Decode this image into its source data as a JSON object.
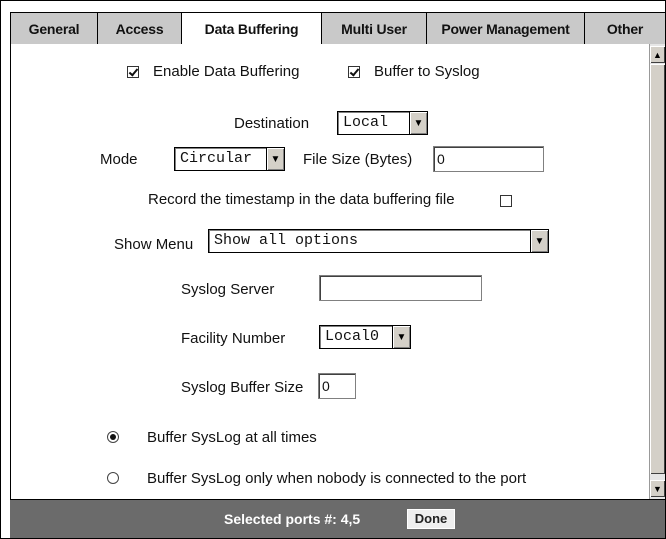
{
  "tabs": [
    {
      "label": "General",
      "active": false
    },
    {
      "label": "Access",
      "active": false
    },
    {
      "label": "Data Buffering",
      "active": true
    },
    {
      "label": "Multi User",
      "active": false
    },
    {
      "label": "Power Management",
      "active": false
    },
    {
      "label": "Other",
      "active": false
    }
  ],
  "options": {
    "enable_data_buffering": {
      "label": "Enable Data Buffering",
      "checked": true
    },
    "buffer_to_syslog": {
      "label": "Buffer to Syslog",
      "checked": true
    }
  },
  "destination": {
    "label": "Destination",
    "value": "Local"
  },
  "mode": {
    "label": "Mode",
    "value": "Circular"
  },
  "file_size": {
    "label": "File Size (Bytes)",
    "value": "0"
  },
  "timestamp": {
    "label": "Record the timestamp in the data buffering file",
    "checked": false
  },
  "show_menu": {
    "label": "Show Menu",
    "value": "Show all options"
  },
  "syslog_server": {
    "label": "Syslog Server",
    "value": ""
  },
  "facility_number": {
    "label": "Facility Number",
    "value": "Local0"
  },
  "syslog_buffer_size": {
    "label": "Syslog Buffer Size",
    "value": "0"
  },
  "buffer_syslog": {
    "all_times": {
      "label": "Buffer SysLog at all times",
      "selected": true
    },
    "nobody_connected": {
      "label": "Buffer SysLog only when nobody is connected to the port",
      "selected": false
    }
  },
  "footer": {
    "selected_ports": "Selected ports #: 4,5",
    "done_label": "Done"
  },
  "colors": {
    "tab_bg": "#c9c9c9",
    "footer_bg": "#6b6b6b",
    "content_bg": "#ffffff"
  }
}
